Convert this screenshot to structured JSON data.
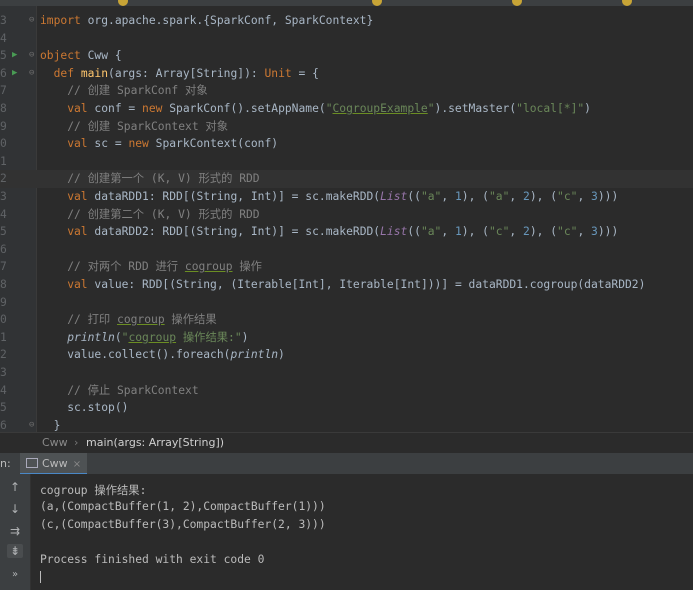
{
  "editor": {
    "lines": [
      {
        "n": "3",
        "run": false,
        "fold": true,
        "cur": false,
        "segs": [
          [
            "import ",
            "kw"
          ],
          [
            "org.apache.spark.{SparkConf, SparkContext}",
            ""
          ]
        ]
      },
      {
        "n": "4",
        "run": false,
        "fold": false,
        "cur": false,
        "segs": []
      },
      {
        "n": "5",
        "run": true,
        "fold": true,
        "cur": false,
        "segs": [
          [
            "object ",
            "kw"
          ],
          [
            "Cww {",
            ""
          ]
        ]
      },
      {
        "n": "6",
        "run": true,
        "fold": true,
        "cur": false,
        "segs": [
          [
            "  def ",
            "kw"
          ],
          [
            "main",
            "fn"
          ],
          [
            "(args: Array[",
            ""
          ],
          [
            "String",
            "ty"
          ],
          [
            "]): ",
            ""
          ],
          [
            "Unit",
            "kw"
          ],
          [
            " = {",
            ""
          ]
        ]
      },
      {
        "n": "7",
        "run": false,
        "fold": false,
        "cur": false,
        "segs": [
          [
            "    // 创建 SparkConf 对象",
            "cm"
          ]
        ]
      },
      {
        "n": "8",
        "run": false,
        "fold": false,
        "cur": false,
        "segs": [
          [
            "    val ",
            "kw"
          ],
          [
            "conf = ",
            ""
          ],
          [
            "new ",
            "kw"
          ],
          [
            "SparkConf().setAppName(",
            ""
          ],
          [
            "\"",
            "str"
          ],
          [
            "CogroupExample",
            "str u"
          ],
          [
            "\"",
            "str"
          ],
          [
            ").setMaster(",
            ""
          ],
          [
            "\"local[*]\"",
            "str"
          ],
          [
            ")",
            ""
          ]
        ]
      },
      {
        "n": "9",
        "run": false,
        "fold": false,
        "cur": false,
        "segs": [
          [
            "    // 创建 SparkContext 对象",
            "cm"
          ]
        ]
      },
      {
        "n": "0",
        "run": false,
        "fold": false,
        "cur": false,
        "segs": [
          [
            "    val ",
            "kw"
          ],
          [
            "sc = ",
            ""
          ],
          [
            "new ",
            "kw"
          ],
          [
            "SparkContext(conf)",
            ""
          ]
        ]
      },
      {
        "n": "1",
        "run": false,
        "fold": false,
        "cur": false,
        "segs": []
      },
      {
        "n": "2",
        "run": false,
        "fold": false,
        "cur": true,
        "segs": [
          [
            "    // 创建第一个 (K, V) 形式的 RDD",
            "cm"
          ]
        ]
      },
      {
        "n": "3",
        "run": false,
        "fold": false,
        "cur": false,
        "segs": [
          [
            "    val ",
            "kw"
          ],
          [
            "dataRDD1: RDD[(",
            ""
          ],
          [
            "String",
            "ty"
          ],
          [
            ", ",
            ""
          ],
          [
            "Int",
            "ty"
          ],
          [
            ")] = sc.makeRDD(",
            ""
          ],
          [
            "List",
            "it"
          ],
          [
            "((",
            ""
          ],
          [
            "\"a\"",
            "str"
          ],
          [
            ", ",
            ""
          ],
          [
            "1",
            "num"
          ],
          [
            "), (",
            ""
          ],
          [
            "\"a\"",
            "str"
          ],
          [
            ", ",
            ""
          ],
          [
            "2",
            "num"
          ],
          [
            "), (",
            ""
          ],
          [
            "\"c\"",
            "str"
          ],
          [
            ", ",
            ""
          ],
          [
            "3",
            "num"
          ],
          [
            ")))",
            ""
          ]
        ]
      },
      {
        "n": "4",
        "run": false,
        "fold": false,
        "cur": false,
        "segs": [
          [
            "    // 创建第二个 (K, V) 形式的 RDD",
            "cm"
          ]
        ]
      },
      {
        "n": "5",
        "run": false,
        "fold": false,
        "cur": false,
        "segs": [
          [
            "    val ",
            "kw"
          ],
          [
            "dataRDD2: RDD[(",
            ""
          ],
          [
            "String",
            "ty"
          ],
          [
            ", ",
            ""
          ],
          [
            "Int",
            "ty"
          ],
          [
            ")] = sc.makeRDD(",
            ""
          ],
          [
            "List",
            "it"
          ],
          [
            "((",
            ""
          ],
          [
            "\"a\"",
            "str"
          ],
          [
            ", ",
            ""
          ],
          [
            "1",
            "num"
          ],
          [
            "), (",
            ""
          ],
          [
            "\"c\"",
            "str"
          ],
          [
            ", ",
            ""
          ],
          [
            "2",
            "num"
          ],
          [
            "), (",
            ""
          ],
          [
            "\"c\"",
            "str"
          ],
          [
            ", ",
            ""
          ],
          [
            "3",
            "num"
          ],
          [
            ")))",
            ""
          ]
        ]
      },
      {
        "n": "6",
        "run": false,
        "fold": false,
        "cur": false,
        "segs": []
      },
      {
        "n": "7",
        "run": false,
        "fold": false,
        "cur": false,
        "segs": [
          [
            "    // 对两个 RDD 进行 ",
            "cm"
          ],
          [
            "cogroup",
            "cm u"
          ],
          [
            " 操作",
            "cm"
          ]
        ]
      },
      {
        "n": "8",
        "run": false,
        "fold": false,
        "cur": false,
        "segs": [
          [
            "    val ",
            "kw"
          ],
          [
            "value: RDD[(",
            ""
          ],
          [
            "String",
            "ty"
          ],
          [
            ", (",
            ""
          ],
          [
            "Iterable",
            "ty"
          ],
          [
            "[",
            ""
          ],
          [
            "Int",
            "ty"
          ],
          [
            "], ",
            ""
          ],
          [
            "Iterable",
            "ty"
          ],
          [
            "[",
            ""
          ],
          [
            "Int",
            "ty"
          ],
          [
            "]))] = dataRDD1.cogroup(dataRDD2)",
            ""
          ]
        ]
      },
      {
        "n": "9",
        "run": false,
        "fold": false,
        "cur": false,
        "segs": []
      },
      {
        "n": "0",
        "run": false,
        "fold": false,
        "cur": false,
        "segs": [
          [
            "    // 打印 ",
            "cm"
          ],
          [
            "cogroup",
            "cm u"
          ],
          [
            " 操作结果",
            "cm"
          ]
        ]
      },
      {
        "n": "1",
        "run": false,
        "fold": false,
        "cur": false,
        "segs": [
          [
            "    ",
            ""
          ],
          [
            "println",
            "it2"
          ],
          [
            "(",
            ""
          ],
          [
            "\"",
            "str"
          ],
          [
            "cogroup",
            "str u"
          ],
          [
            " 操作结果:\"",
            "str"
          ],
          [
            ")",
            ""
          ]
        ]
      },
      {
        "n": "2",
        "run": false,
        "fold": false,
        "cur": false,
        "segs": [
          [
            "    value.collect().foreach(",
            ""
          ],
          [
            "println",
            "it2"
          ],
          [
            ")",
            ""
          ]
        ]
      },
      {
        "n": "3",
        "run": false,
        "fold": false,
        "cur": false,
        "segs": []
      },
      {
        "n": "4",
        "run": false,
        "fold": false,
        "cur": false,
        "segs": [
          [
            "    // 停止 SparkContext",
            "cm"
          ]
        ]
      },
      {
        "n": "5",
        "run": false,
        "fold": false,
        "cur": false,
        "segs": [
          [
            "    sc.stop()",
            ""
          ]
        ]
      },
      {
        "n": "6",
        "run": false,
        "fold": true,
        "cur": false,
        "segs": [
          [
            "  }",
            ""
          ]
        ]
      }
    ]
  },
  "breadcrumb": {
    "object": "Cww",
    "separator": "›",
    "method": "main(args: Array[String])"
  },
  "run_panel": {
    "label": "n:",
    "tab_label": "Cww",
    "close": "×"
  },
  "console": {
    "side_icons": [
      "↑",
      "↓",
      "⇉",
      "⇟",
      "»"
    ],
    "lines": [
      "cogroup 操作结果:",
      "(a,(CompactBuffer(1, 2),CompactBuffer(1)))",
      "(c,(CompactBuffer(3),CompactBuffer(2, 3)))",
      "",
      "Process finished with exit code 0"
    ]
  },
  "colors": {
    "background": "#2b2b2b",
    "keyword": "#cc7832",
    "string": "#6a8759",
    "number": "#6897bb",
    "comment": "#808080",
    "function": "#ffc66d"
  }
}
